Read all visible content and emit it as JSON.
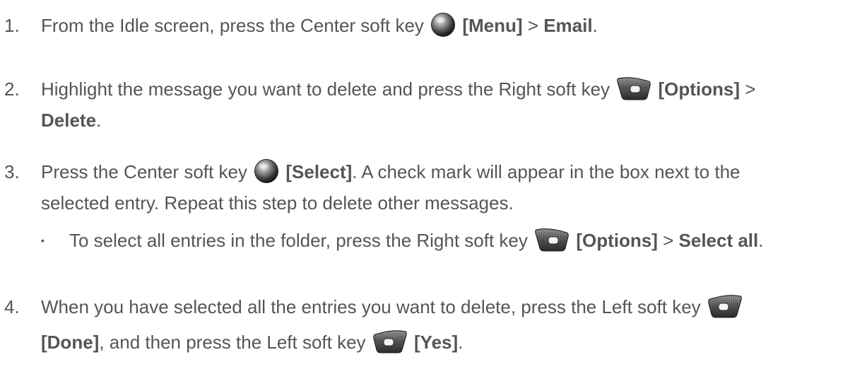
{
  "steps": [
    {
      "number": "1.",
      "lines": [
        {
          "pre": "From the Idle screen, press the Center soft key ",
          "icon": "center-soft-key-icon",
          "bold1": "[Menu]",
          "mid": " > ",
          "bold2": "Email",
          "post": "."
        }
      ]
    },
    {
      "number": "2.",
      "lines": [
        {
          "pre": "Highlight the message you want to delete and press the Right soft key ",
          "icon": "right-soft-key-icon",
          "bold1": "[Options]",
          "post": " >"
        },
        {
          "bold1": "Delete",
          "post": "."
        }
      ]
    },
    {
      "number": "3.",
      "lines": [
        {
          "pre": "Press the Center soft key ",
          "icon": "center-soft-key-icon",
          "bold1": "[Select]",
          "post": ". A check mark will appear in the box next to the"
        },
        {
          "pre": "selected entry. Repeat this step to delete other messages."
        }
      ],
      "sub": {
        "bullet": "▪",
        "pre": "To select all entries in the folder, press the Right soft key ",
        "icon": "right-soft-key-icon",
        "bold1": "[Options]",
        "mid": " > ",
        "bold2": "Select all",
        "post": "."
      }
    },
    {
      "number": "4.",
      "lines": [
        {
          "pre": "When you have selected all the entries you want to delete, press the Left soft key ",
          "icon": "left-soft-key-icon"
        },
        {
          "bold1": "[Done]",
          "mid": ", and then press the Left soft key ",
          "icon2": "left-soft-key-icon",
          "bold2": "[Yes]",
          "post": "."
        }
      ]
    }
  ]
}
